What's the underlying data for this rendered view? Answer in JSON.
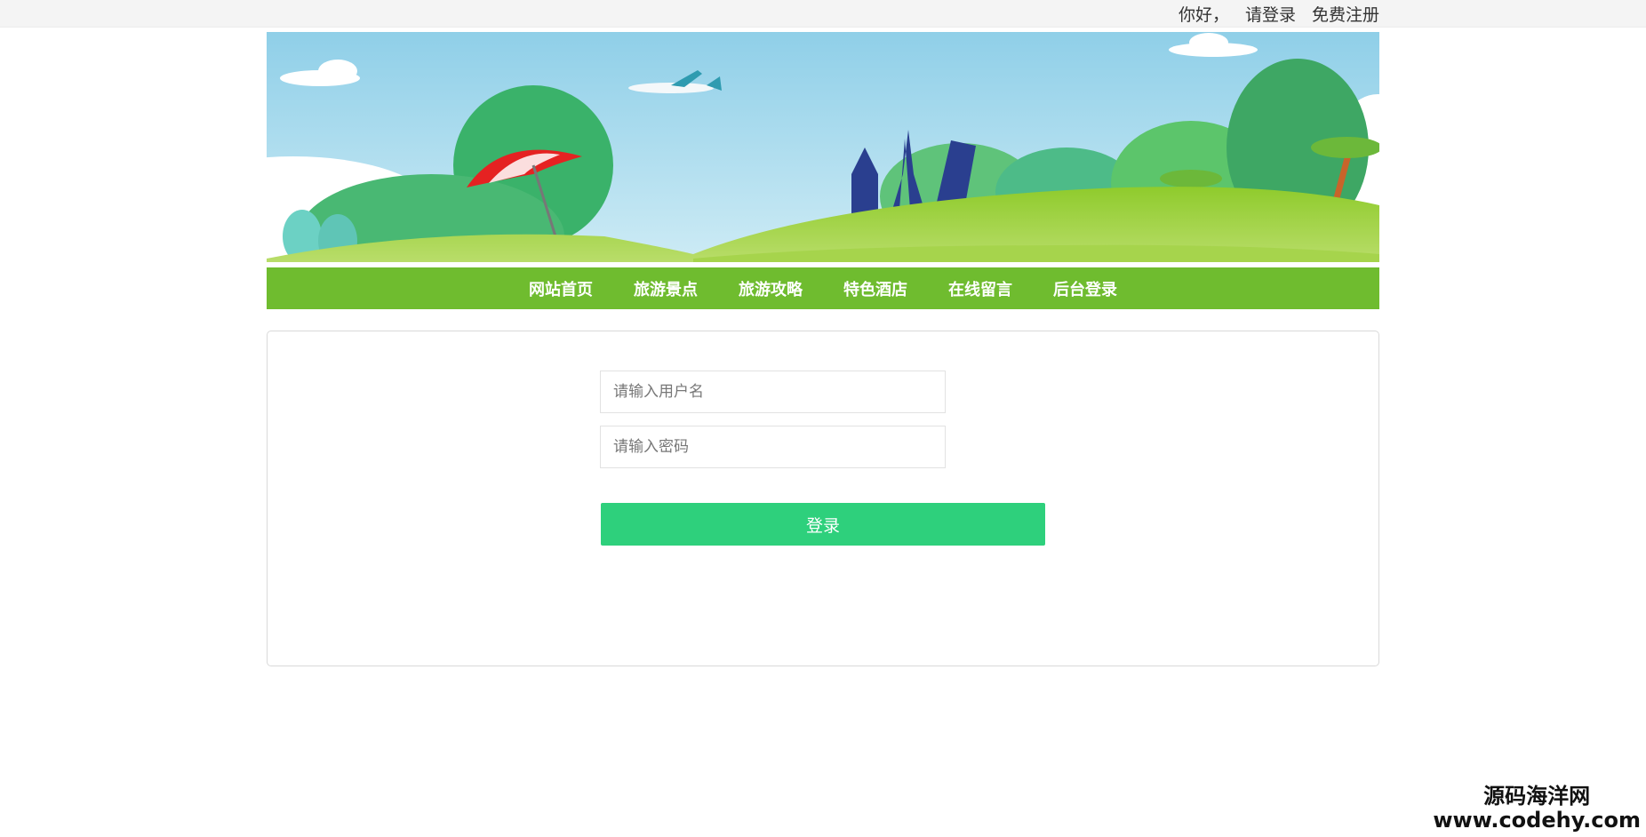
{
  "topbar": {
    "greeting": "你好，",
    "login_link": "请登录",
    "register_link": "免费注册"
  },
  "nav": {
    "items": [
      "网站首页",
      "旅游景点",
      "旅游攻略",
      "特色酒店",
      "在线留言",
      "后台登录"
    ]
  },
  "login_form": {
    "username_placeholder": "请输入用户名",
    "password_placeholder": "请输入密码",
    "submit_label": "登录"
  },
  "watermark": {
    "line1": "源码海洋网",
    "line2": "www.codehy.com"
  },
  "colors": {
    "nav_bg": "#6fbc2f",
    "button_bg": "#2ed07c",
    "sky": "#9ed6ec"
  }
}
